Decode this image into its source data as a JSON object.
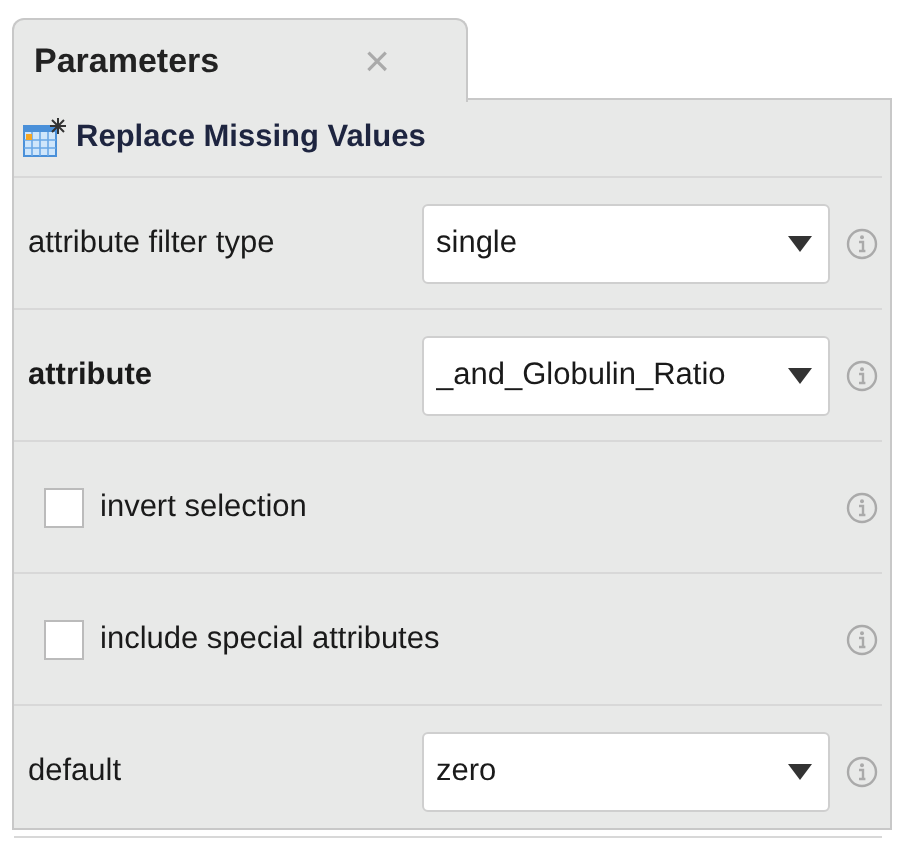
{
  "tab": {
    "title": "Parameters",
    "close": "×"
  },
  "operator": {
    "title": "Replace Missing Values"
  },
  "parameters": [
    {
      "kind": "select",
      "label": "attribute filter type",
      "bold": false,
      "value": "single"
    },
    {
      "kind": "select",
      "label": "attribute",
      "bold": true,
      "value": "_and_Globulin_Ratio"
    },
    {
      "kind": "checkbox",
      "label": "invert selection",
      "checked": false
    },
    {
      "kind": "checkbox",
      "label": "include special attributes",
      "checked": false
    },
    {
      "kind": "select",
      "label": "default",
      "bold": false,
      "value": "zero"
    }
  ]
}
